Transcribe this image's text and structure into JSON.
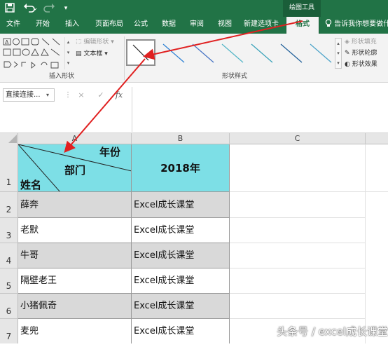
{
  "contextual_tab_group": "绘图工具",
  "ribbon_tabs": [
    "文件",
    "开始",
    "插入",
    "页面布局",
    "公式",
    "数据",
    "审阅",
    "视图",
    "新建选项卡",
    "格式"
  ],
  "active_tab": "格式",
  "tell_me": "告诉我你想要做什么",
  "ribbon": {
    "insert_shapes": {
      "label": "插入形状",
      "edit_shape": "编辑形状",
      "text_box": "文本框"
    },
    "shape_styles": {
      "label": "形状样式",
      "fill": "形状填充",
      "outline": "形状轮廓",
      "effects": "形状效果"
    }
  },
  "name_box": "直接连接...",
  "formula_buttons": {
    "cancel": "×",
    "enter": "✓",
    "fx": "fx"
  },
  "columns": [
    "A",
    "B",
    "C"
  ],
  "header_cell": {
    "top_right": "年份",
    "middle": "部门",
    "bottom_left": "姓名"
  },
  "header_b": "2018年",
  "rows": [
    {
      "num": "1"
    },
    {
      "num": "2",
      "a": "薛奔",
      "b": "Excel成长课堂"
    },
    {
      "num": "3",
      "a": "老默",
      "b": "Excel成长课堂"
    },
    {
      "num": "4",
      "a": "牛哥",
      "b": "Excel成长课堂"
    },
    {
      "num": "5",
      "a": "隔壁老王",
      "b": "Excel成长课堂"
    },
    {
      "num": "6",
      "a": "小猪佩奇",
      "b": "Excel成长课堂"
    },
    {
      "num": "7",
      "a": "麦兜",
      "b": "Excel成长课堂"
    }
  ],
  "watermark": "头条号 / excel成长课堂",
  "colors": {
    "excel_green": "#217346",
    "header_cyan": "#7ddfe6",
    "row_gray": "#d9d9d9",
    "arrow_red": "#e02020"
  },
  "icons": {
    "save": "save-icon",
    "undo": "undo-icon",
    "redo": "redo-icon",
    "customize": "customize-qa-icon",
    "lightbulb": "lightbulb-icon",
    "paint_bucket": "paint-bucket-icon",
    "pen": "pen-outline-icon",
    "effects": "effects-icon"
  }
}
